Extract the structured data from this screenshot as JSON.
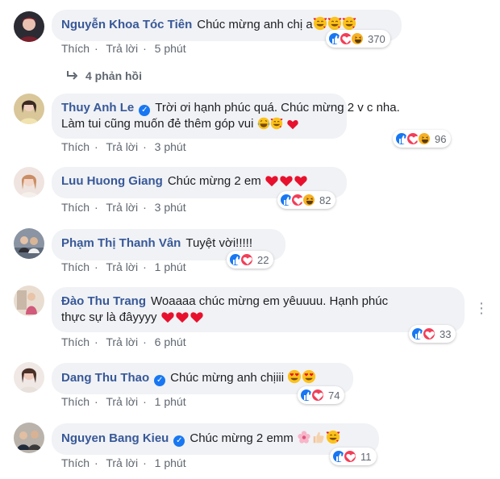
{
  "ui": {
    "like": "Thích",
    "reply": "Trả lời",
    "sep": "·"
  },
  "reply_toggle": "4 phản hồi",
  "comments": [
    {
      "name": "Nguyễn Khoa Tóc Tiên",
      "text": "Chúc mừng anh chị a",
      "time": "5 phút",
      "reactions": "370"
    },
    {
      "name": "Thuy Anh Le",
      "line1": "Trời ơi hạnh phúc quá. Chúc mừng 2 v c nha.",
      "line2": "Làm tui cũng muốn đẻ thêm góp vui",
      "time": "3 phút",
      "reactions": "96"
    },
    {
      "name": "Luu Huong Giang",
      "text": "Chúc mừng 2 em",
      "time": "3 phút",
      "reactions": "82"
    },
    {
      "name": "Phạm Thị Thanh Vân",
      "text": "Tuyệt vời!!!!!",
      "time": "1 phút",
      "reactions": "22"
    },
    {
      "name": "Đào Thu Trang",
      "line1": "Woaaaa chúc mừng em yêuuuu. Hạnh phúc",
      "line2": "thực sự là đâyyyy",
      "time": "6 phút",
      "reactions": "33"
    },
    {
      "name": "Dang Thu Thao",
      "text": "Chúc mừng anh chịiii",
      "time": "1 phút",
      "reactions": "74"
    },
    {
      "name": "Nguyen Bang Kieu",
      "text": "Chúc mừng 2 emm",
      "time": "1 phút",
      "reactions": "11"
    }
  ],
  "colors": {
    "name": "#385898",
    "bubble": "#f0f2f5",
    "like": "#1877f2",
    "love": "#f33e58",
    "haha": "#f7b125"
  }
}
